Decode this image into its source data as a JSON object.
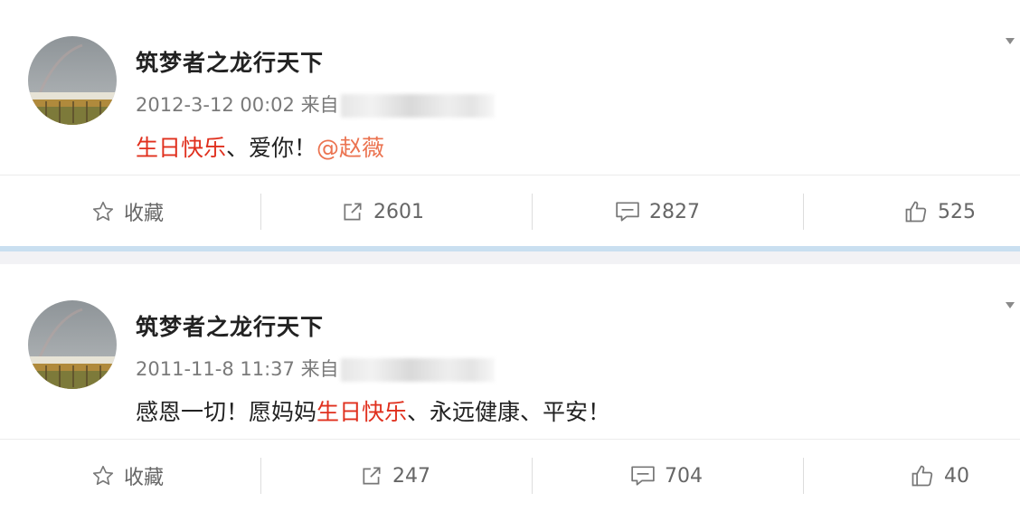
{
  "posts": [
    {
      "username": "筑梦者之龙行天下",
      "timestamp": "2012-3-12 00:02",
      "source_prefix": "来自",
      "content": {
        "highlight": "生日快乐",
        "text": "、爱你！",
        "mention": "@赵薇"
      },
      "actions": {
        "favorite_label": "收藏",
        "repost_count": "2601",
        "comment_count": "2827",
        "like_count": "525"
      }
    },
    {
      "username": "筑梦者之龙行天下",
      "timestamp": "2011-11-8 11:37",
      "source_prefix": "来自",
      "content": {
        "prefix": "感恩一切！愿妈妈",
        "highlight": "生日快乐",
        "suffix": "、永远健康、平安！"
      },
      "actions": {
        "favorite_label": "收藏",
        "repost_count": "247",
        "comment_count": "704",
        "like_count": "40"
      }
    }
  ],
  "colors": {
    "highlight": "#e0301e",
    "mention": "#eb7350",
    "separator": "#c9dff0"
  },
  "icons": [
    "star-icon",
    "repost-icon",
    "comment-icon",
    "thumbs-up-icon",
    "chevron-down-icon"
  ]
}
